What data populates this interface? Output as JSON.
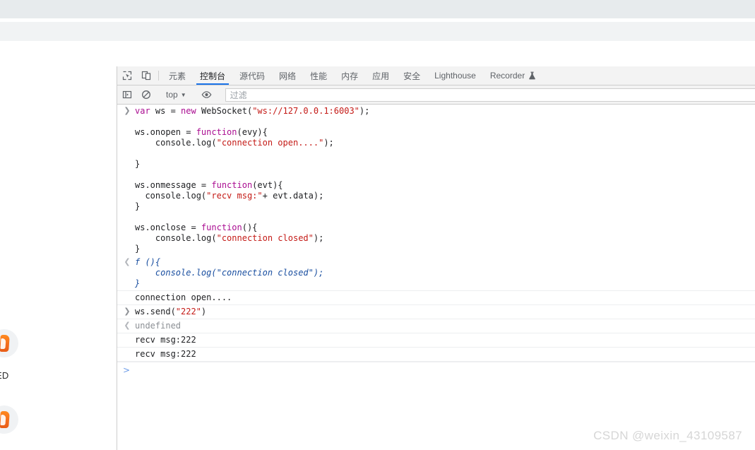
{
  "window": {
    "watermark": "CSDN @weixin_43109587"
  },
  "page_background": {
    "side_label": "ED",
    "avatar_icon": "flame-logo-icon"
  },
  "devtools": {
    "toolbar_icons": {
      "inspect": "inspect-element-icon",
      "device": "device-toolbar-icon"
    },
    "tabs": [
      {
        "label": "元素",
        "active": false,
        "cjk": true
      },
      {
        "label": "控制台",
        "active": true,
        "cjk": true
      },
      {
        "label": "源代码",
        "active": false,
        "cjk": true
      },
      {
        "label": "网络",
        "active": false,
        "cjk": true
      },
      {
        "label": "性能",
        "active": false,
        "cjk": true
      },
      {
        "label": "内存",
        "active": false,
        "cjk": true
      },
      {
        "label": "应用",
        "active": false,
        "cjk": true
      },
      {
        "label": "安全",
        "active": false,
        "cjk": true
      },
      {
        "label": "Lighthouse",
        "active": false,
        "cjk": false
      },
      {
        "label": "Recorder",
        "active": false,
        "cjk": false,
        "icon": "flask-icon"
      }
    ],
    "console_toolbar": {
      "sidebar_icon": "console-sidebar-icon",
      "clear_icon": "clear-console-icon",
      "context": "top",
      "context_caret": "▼",
      "eye_icon": "live-expression-eye-icon",
      "filter_placeholder": "过滤"
    },
    "accent_color": "#1a73e8"
  },
  "console": {
    "entries": [
      {
        "gutter": "input",
        "separator": false,
        "lines": [
          [
            {
              "t": "var ",
              "c": "kw"
            },
            {
              "t": "ws = ",
              "c": "plain"
            },
            {
              "t": "new ",
              "c": "kw"
            },
            {
              "t": "WebSocket(",
              "c": "plain"
            },
            {
              "t": "\"ws://127.0.0.1:6003\"",
              "c": "str"
            },
            {
              "t": ");",
              "c": "plain"
            }
          ],
          [
            {
              "t": "",
              "c": "plain"
            }
          ],
          [
            {
              "t": "ws.onopen = ",
              "c": "plain"
            },
            {
              "t": "function",
              "c": "fn"
            },
            {
              "t": "(evy){",
              "c": "plain"
            }
          ],
          [
            {
              "t": "    console.log(",
              "c": "plain"
            },
            {
              "t": "\"connection open....\"",
              "c": "str"
            },
            {
              "t": ");",
              "c": "plain"
            }
          ],
          [
            {
              "t": "",
              "c": "plain"
            }
          ],
          [
            {
              "t": "}",
              "c": "plain"
            }
          ],
          [
            {
              "t": "",
              "c": "plain"
            }
          ],
          [
            {
              "t": "ws.onmessage = ",
              "c": "plain"
            },
            {
              "t": "function",
              "c": "fn"
            },
            {
              "t": "(evt){",
              "c": "plain"
            }
          ],
          [
            {
              "t": "  console.log(",
              "c": "plain"
            },
            {
              "t": "\"recv msg:\"",
              "c": "str"
            },
            {
              "t": "+ evt.data);",
              "c": "plain"
            }
          ],
          [
            {
              "t": "}",
              "c": "plain"
            }
          ],
          [
            {
              "t": "",
              "c": "plain"
            }
          ],
          [
            {
              "t": "ws.onclose = ",
              "c": "plain"
            },
            {
              "t": "function",
              "c": "fn"
            },
            {
              "t": "(){",
              "c": "plain"
            }
          ],
          [
            {
              "t": "    console.log(",
              "c": "plain"
            },
            {
              "t": "\"connection closed\"",
              "c": "str"
            },
            {
              "t": ");",
              "c": "plain"
            }
          ],
          [
            {
              "t": "}",
              "c": "plain"
            }
          ]
        ]
      },
      {
        "gutter": "output",
        "separator": false,
        "lines": [
          [
            {
              "t": "f (){",
              "c": "ret"
            }
          ],
          [
            {
              "t": "    console.log(\"connection closed\");",
              "c": "ret"
            }
          ],
          [
            {
              "t": "}",
              "c": "ret"
            }
          ]
        ]
      },
      {
        "gutter": "none",
        "separator": true,
        "lines": [
          [
            {
              "t": "connection open....",
              "c": "plain"
            }
          ]
        ]
      },
      {
        "gutter": "input",
        "separator": true,
        "lines": [
          [
            {
              "t": "ws.send(",
              "c": "plain"
            },
            {
              "t": "\"222\"",
              "c": "str"
            },
            {
              "t": ")",
              "c": "plain"
            }
          ]
        ]
      },
      {
        "gutter": "output",
        "separator": true,
        "lines": [
          [
            {
              "t": "undefined",
              "c": "dim"
            }
          ]
        ]
      },
      {
        "gutter": "none",
        "separator": true,
        "lines": [
          [
            {
              "t": "recv msg:222",
              "c": "plain"
            }
          ]
        ]
      },
      {
        "gutter": "none",
        "separator": true,
        "lines": [
          [
            {
              "t": "recv msg:222",
              "c": "plain"
            }
          ]
        ]
      }
    ],
    "prompt_chevron": ">",
    "prompt_value": ""
  }
}
